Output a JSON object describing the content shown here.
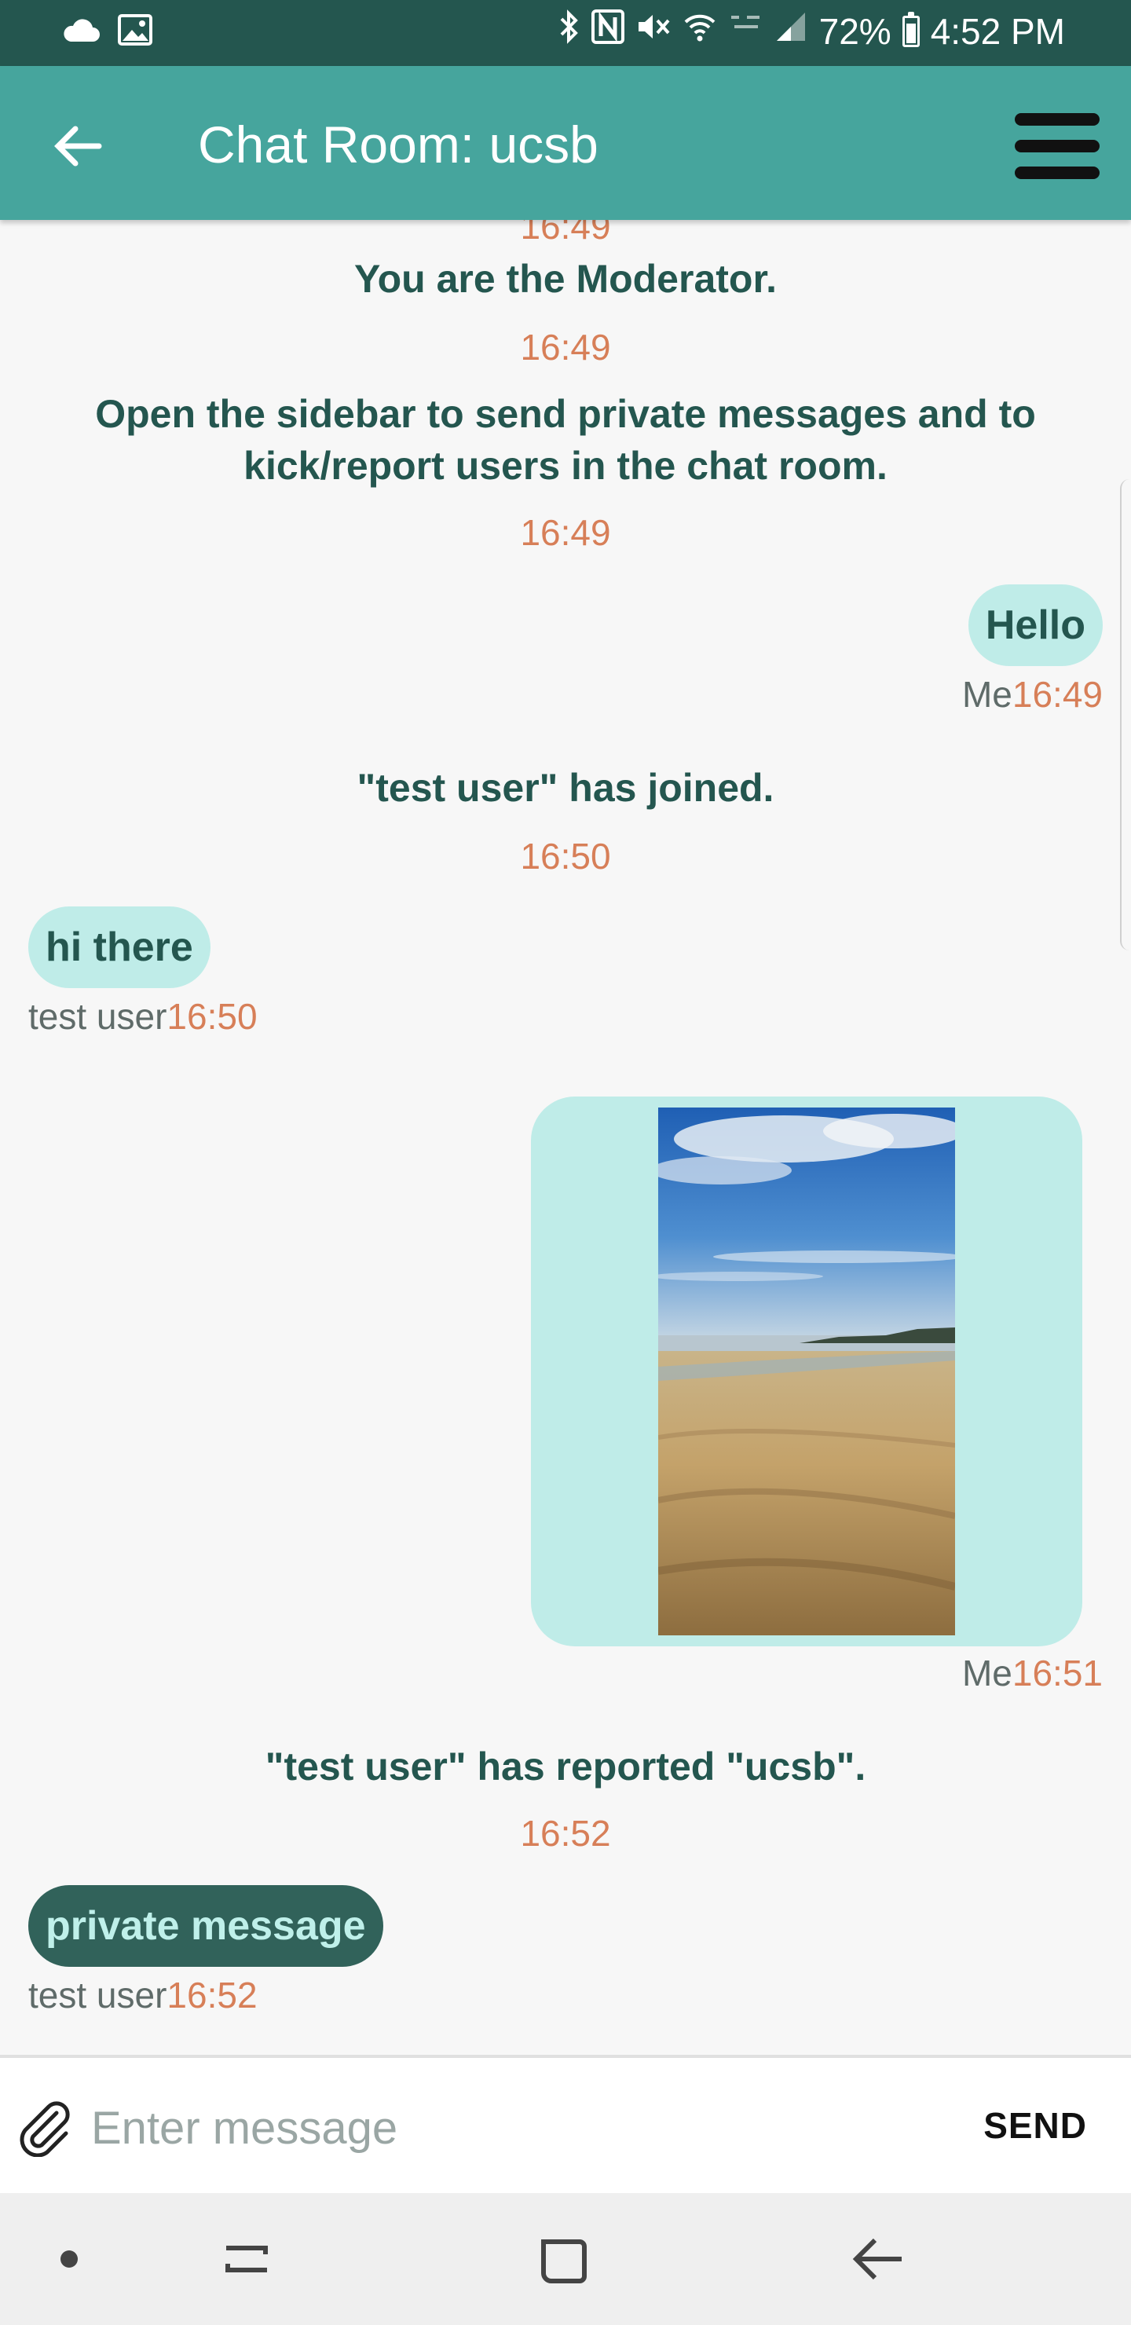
{
  "status_bar": {
    "battery": "72%",
    "time": "4:52 PM",
    "battery_level": 0.72,
    "icons": [
      "cloud-icon",
      "image-icon",
      "bluetooth-icon",
      "nfc-icon",
      "mute-icon",
      "wifi-icon",
      "lte-icon",
      "signal-icon",
      "battery-icon"
    ]
  },
  "app_bar": {
    "title": "Chat Room: ucsb",
    "colors": {
      "app_bar": "#46a59d",
      "status_bar": "#24564f"
    }
  },
  "messages": {
    "top_time": "16:49",
    "moderator_text": "You are the Moderator.",
    "moderator_time": "16:49",
    "sidebar_text": "Open the sidebar to send private messages and to kick/report users in the chat room.",
    "sidebar_time": "16:49",
    "hello": {
      "text": "Hello",
      "sender": "Me",
      "time": "16:49"
    },
    "joined_text": "\"test user\" has joined.",
    "joined_time": "16:50",
    "hi_there": {
      "text": "hi there",
      "sender": "test user",
      "time": "16:50"
    },
    "image_message": {
      "sender": "Me",
      "time": "16:51"
    },
    "reported_text": "\"test user\" has reported \"ucsb\".",
    "reported_time": "16:52",
    "private": {
      "text": "private message",
      "sender": "test user",
      "time": "16:52"
    }
  },
  "input": {
    "placeholder": "Enter message",
    "send_label": "SEND"
  },
  "colors": {
    "bubble": "#bfece8",
    "bubble_dark": "#31625a",
    "text_dark": "#24564f",
    "time": "#d77f58"
  }
}
